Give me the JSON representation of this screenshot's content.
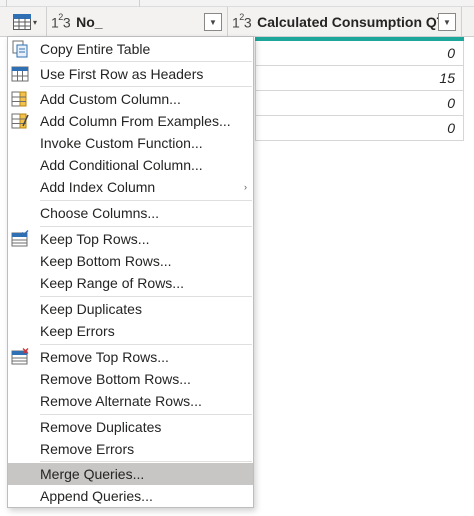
{
  "header": {
    "col1": {
      "type_base": "1",
      "type_sup": "2",
      "type_tail": "3",
      "name": "No_"
    },
    "col2": {
      "type_base": "1",
      "type_sup": "2",
      "type_tail": "3",
      "name": "Calculated Consumption QTY"
    }
  },
  "cells": [
    "0",
    "15",
    "0",
    "0"
  ],
  "colors": {
    "quality_bar": "#1fa69a",
    "highlight": "#c8c6c4"
  },
  "menu": {
    "items": [
      {
        "label": "Copy Entire Table",
        "icon": "copy-table-icon"
      },
      {
        "label": "Use First Row as Headers",
        "icon": "first-row-headers-icon"
      },
      {
        "label": "Add Custom Column...",
        "icon": "custom-column-icon"
      },
      {
        "label": "Add Column From Examples...",
        "icon": "column-from-examples-icon"
      },
      {
        "label": "Invoke Custom Function..."
      },
      {
        "label": "Add Conditional Column..."
      },
      {
        "label": "Add Index Column",
        "submenu": "›"
      },
      {
        "label": "Choose Columns..."
      },
      {
        "label": "Keep Top Rows...",
        "icon": "keep-rows-icon"
      },
      {
        "label": "Keep Bottom Rows..."
      },
      {
        "label": "Keep Range of Rows..."
      },
      {
        "label": "Keep Duplicates"
      },
      {
        "label": "Keep Errors"
      },
      {
        "label": "Remove Top Rows...",
        "icon": "remove-rows-icon"
      },
      {
        "label": "Remove Bottom Rows..."
      },
      {
        "label": "Remove Alternate Rows..."
      },
      {
        "label": "Remove Duplicates"
      },
      {
        "label": "Remove Errors"
      },
      {
        "label": "Merge Queries...",
        "highlighted": true
      },
      {
        "label": "Append Queries..."
      }
    ]
  }
}
